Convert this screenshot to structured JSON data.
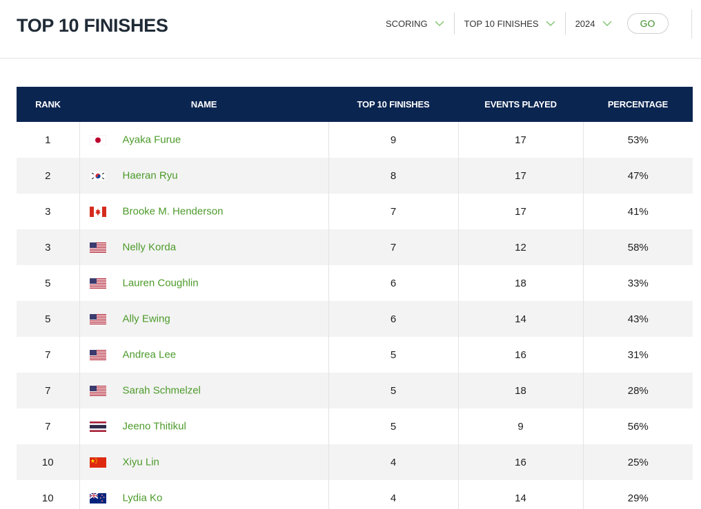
{
  "header": {
    "title": "TOP 10 FINISHES",
    "filters": [
      {
        "label": "SCORING"
      },
      {
        "label": "TOP 10 FINISHES"
      },
      {
        "label": "2024"
      }
    ],
    "go_label": "GO"
  },
  "table": {
    "columns": [
      "RANK",
      "NAME",
      "TOP 10 FINISHES",
      "EVENTS PLAYED",
      "PERCENTAGE"
    ],
    "rows": [
      {
        "rank": "1",
        "flag": "japan-flag",
        "name": "Ayaka Furue",
        "top10": "9",
        "events": "17",
        "pct": "53%"
      },
      {
        "rank": "2",
        "flag": "korea-flag",
        "name": "Haeran Ryu",
        "top10": "8",
        "events": "17",
        "pct": "47%"
      },
      {
        "rank": "3",
        "flag": "canada-flag",
        "name": "Brooke M. Henderson",
        "top10": "7",
        "events": "17",
        "pct": "41%"
      },
      {
        "rank": "3",
        "flag": "usa-flag",
        "name": "Nelly Korda",
        "top10": "7",
        "events": "12",
        "pct": "58%"
      },
      {
        "rank": "5",
        "flag": "usa-flag",
        "name": "Lauren Coughlin",
        "top10": "6",
        "events": "18",
        "pct": "33%"
      },
      {
        "rank": "5",
        "flag": "usa-flag",
        "name": "Ally Ewing",
        "top10": "6",
        "events": "14",
        "pct": "43%"
      },
      {
        "rank": "7",
        "flag": "usa-flag",
        "name": "Andrea Lee",
        "top10": "5",
        "events": "16",
        "pct": "31%"
      },
      {
        "rank": "7",
        "flag": "usa-flag",
        "name": "Sarah Schmelzel",
        "top10": "5",
        "events": "18",
        "pct": "28%"
      },
      {
        "rank": "7",
        "flag": "thailand-flag",
        "name": "Jeeno Thitikul",
        "top10": "5",
        "events": "9",
        "pct": "56%"
      },
      {
        "rank": "10",
        "flag": "china-flag",
        "name": "Xiyu Lin",
        "top10": "4",
        "events": "16",
        "pct": "25%"
      },
      {
        "rank": "10",
        "flag": "new-zealand-flag",
        "name": "Lydia Ko",
        "top10": "4",
        "events": "14",
        "pct": "29%"
      }
    ]
  },
  "colors": {
    "header_bg": "#0b2551",
    "link_green": "#4c9a2a",
    "row_alt": "#f3f3f3"
  }
}
